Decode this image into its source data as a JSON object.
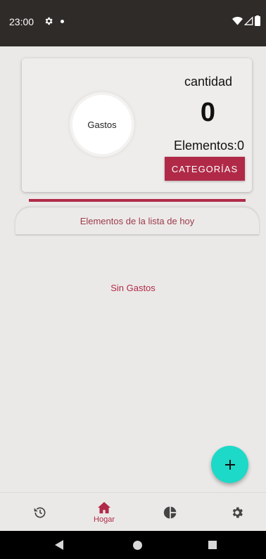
{
  "status_bar": {
    "time": "23:00",
    "icons": [
      "gear-icon",
      "notification-dot",
      "wifi-icon",
      "signal-icon",
      "battery-icon"
    ]
  },
  "summary": {
    "circle_label": "Gastos",
    "cantidad_label": "cantidad",
    "cantidad_value": "0",
    "elementos_label": "Elementos:0",
    "categorias_button": "CATEGORÍAS"
  },
  "list": {
    "header": "Elementos de la lista de hoy",
    "empty_text": "Sin Gastos"
  },
  "fab": {
    "icon": "plus-icon"
  },
  "bottom_nav": {
    "items": [
      {
        "icon": "history-icon",
        "label": "",
        "active": false
      },
      {
        "icon": "home-icon",
        "label": "Hogar",
        "active": true
      },
      {
        "icon": "pie-chart-icon",
        "label": "",
        "active": false
      },
      {
        "icon": "settings-icon",
        "label": "",
        "active": false
      }
    ]
  },
  "colors": {
    "accent": "#b02a48",
    "fab": "#1dd9c8",
    "status_bar": "#2e2b28",
    "background": "#ebe9e7"
  }
}
